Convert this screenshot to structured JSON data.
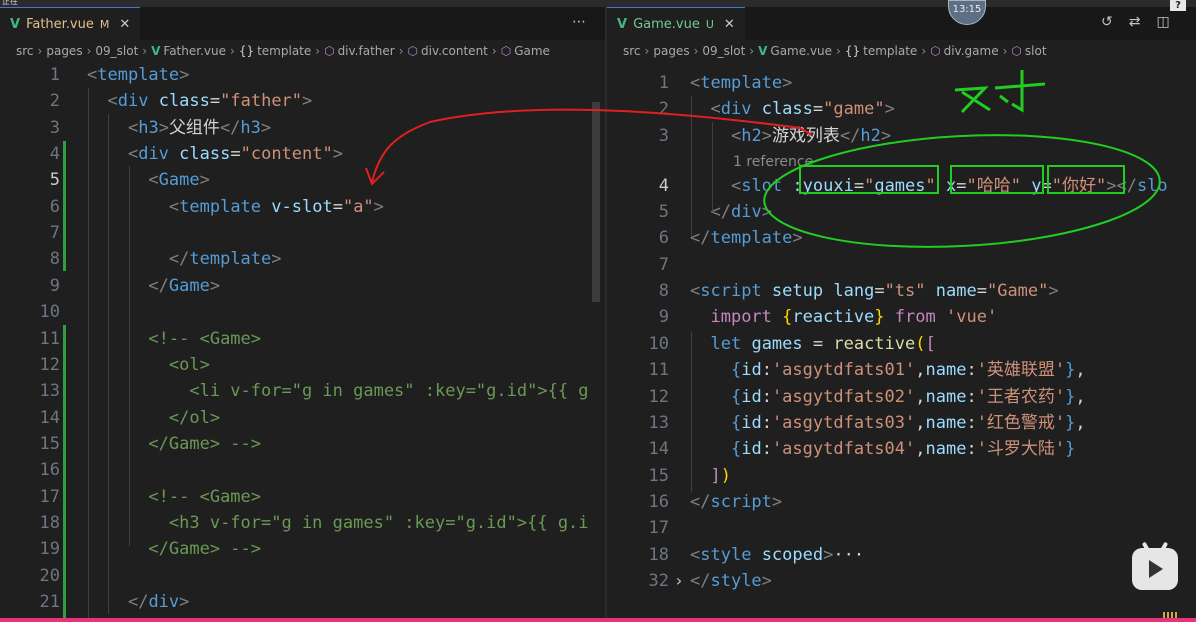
{
  "top_strip_label": "正在",
  "avatar_time": "13:15",
  "help_label": "?",
  "colors": {
    "accent_pink": "#e5357a",
    "annotation_red": "#e02020",
    "annotation_green": "#22cc22",
    "vue_green": "#41b883"
  },
  "left": {
    "tab": {
      "icon": "vue-icon",
      "name": "Father.vue",
      "flag": "M",
      "close": "✕"
    },
    "breadcrumb": [
      "src",
      "pages",
      "09_slot",
      "Father.vue",
      "template",
      "div.father",
      "div.content",
      "Game"
    ],
    "lines": [
      {
        "n": "1",
        "html_parts": [
          [
            "t",
            "<"
          ],
          [
            "tg",
            "template"
          ],
          [
            "t",
            ">"
          ]
        ]
      },
      {
        "n": "2",
        "html_parts": [
          [
            "pl",
            "  "
          ],
          [
            "t",
            "<"
          ],
          [
            "tg",
            "div"
          ],
          [
            "pl",
            " "
          ],
          [
            "at",
            "class"
          ],
          [
            "pl",
            "="
          ],
          [
            "st",
            "\"father\""
          ],
          [
            "t",
            ">"
          ]
        ]
      },
      {
        "n": "3",
        "html_parts": [
          [
            "pl",
            "    "
          ],
          [
            "t",
            "<"
          ],
          [
            "tg",
            "h3"
          ],
          [
            "t",
            ">"
          ],
          [
            "pl",
            "父组件"
          ],
          [
            "t",
            "</"
          ],
          [
            "tg",
            "h3"
          ],
          [
            "t",
            ">"
          ]
        ]
      },
      {
        "n": "4",
        "html_parts": [
          [
            "pl",
            "    "
          ],
          [
            "t",
            "<"
          ],
          [
            "tg",
            "div"
          ],
          [
            "pl",
            " "
          ],
          [
            "at",
            "class"
          ],
          [
            "pl",
            "="
          ],
          [
            "st",
            "\"content\""
          ],
          [
            "t",
            ">"
          ]
        ]
      },
      {
        "n": "5",
        "html_parts": [
          [
            "pl",
            "      "
          ],
          [
            "t",
            "<"
          ],
          [
            "tg",
            "Game"
          ],
          [
            "t",
            ">"
          ]
        ]
      },
      {
        "n": "6",
        "html_parts": [
          [
            "pl",
            "        "
          ],
          [
            "t",
            "<"
          ],
          [
            "tg",
            "template"
          ],
          [
            "pl",
            " "
          ],
          [
            "at",
            "v-slot"
          ],
          [
            "pl",
            "="
          ],
          [
            "st",
            "\"a\""
          ],
          [
            "t",
            ">"
          ]
        ]
      },
      {
        "n": "7",
        "html_parts": []
      },
      {
        "n": "8",
        "html_parts": [
          [
            "pl",
            "        "
          ],
          [
            "t",
            "</"
          ],
          [
            "tg",
            "template"
          ],
          [
            "t",
            ">"
          ]
        ]
      },
      {
        "n": "9",
        "html_parts": [
          [
            "pl",
            "      "
          ],
          [
            "t",
            "</"
          ],
          [
            "tg",
            "Game"
          ],
          [
            "t",
            ">"
          ]
        ]
      },
      {
        "n": "10",
        "html_parts": []
      },
      {
        "n": "11",
        "html_parts": [
          [
            "pl",
            "      "
          ],
          [
            "cm",
            "<!-- <Game>"
          ]
        ]
      },
      {
        "n": "12",
        "html_parts": [
          [
            "pl",
            "        "
          ],
          [
            "cm",
            "<ol>"
          ]
        ]
      },
      {
        "n": "13",
        "html_parts": [
          [
            "pl",
            "          "
          ],
          [
            "cm",
            "<li v-for=\"g in games\" :key=\"g.id\">{{ g"
          ]
        ]
      },
      {
        "n": "14",
        "html_parts": [
          [
            "pl",
            "        "
          ],
          [
            "cm",
            "</ol>"
          ]
        ]
      },
      {
        "n": "15",
        "html_parts": [
          [
            "pl",
            "      "
          ],
          [
            "cm",
            "</Game> -->"
          ]
        ]
      },
      {
        "n": "16",
        "html_parts": []
      },
      {
        "n": "17",
        "html_parts": [
          [
            "pl",
            "      "
          ],
          [
            "cm",
            "<!-- <Game>"
          ]
        ]
      },
      {
        "n": "18",
        "html_parts": [
          [
            "pl",
            "        "
          ],
          [
            "cm",
            "<h3 v-for=\"g in games\" :key=\"g.id\">{{ g.i"
          ]
        ]
      },
      {
        "n": "19",
        "html_parts": [
          [
            "pl",
            "      "
          ],
          [
            "cm",
            "</Game> -->"
          ]
        ]
      },
      {
        "n": "20",
        "html_parts": []
      },
      {
        "n": "21",
        "html_parts": [
          [
            "pl",
            "    "
          ],
          [
            "t",
            "</"
          ],
          [
            "tg",
            "div"
          ],
          [
            "t",
            ">"
          ]
        ]
      }
    ]
  },
  "right": {
    "tab": {
      "icon": "vue-icon",
      "name": "Game.vue",
      "flag": "U",
      "close": "✕"
    },
    "breadcrumb": [
      "src",
      "pages",
      "09_slot",
      "Game.vue",
      "template",
      "div.game",
      "slot"
    ],
    "reference_lens": "1 reference",
    "lines": [
      {
        "n": "1",
        "html_parts": [
          [
            "t",
            "<"
          ],
          [
            "tg",
            "template"
          ],
          [
            "t",
            ">"
          ]
        ]
      },
      {
        "n": "2",
        "html_parts": [
          [
            "pl",
            "  "
          ],
          [
            "t",
            "<"
          ],
          [
            "tg",
            "div"
          ],
          [
            "pl",
            " "
          ],
          [
            "at",
            "class"
          ],
          [
            "pl",
            "="
          ],
          [
            "st",
            "\"game\""
          ],
          [
            "t",
            ">"
          ]
        ]
      },
      {
        "n": "3",
        "html_parts": [
          [
            "pl",
            "    "
          ],
          [
            "t",
            "<"
          ],
          [
            "tg",
            "h2"
          ],
          [
            "t",
            ">"
          ],
          [
            "pl",
            "游戏列表"
          ],
          [
            "t",
            "</"
          ],
          [
            "tg",
            "h2"
          ],
          [
            "t",
            ">"
          ]
        ]
      },
      {
        "n": "4",
        "html_parts": [
          [
            "pl",
            "    "
          ],
          [
            "t",
            "<"
          ],
          [
            "tg",
            "slot"
          ],
          [
            "pl",
            " "
          ],
          [
            "at",
            ":youxi"
          ],
          [
            "pl",
            "="
          ],
          [
            "st",
            "\""
          ],
          [
            "vr",
            "games"
          ],
          [
            "st",
            "\""
          ],
          [
            "pl",
            " "
          ],
          [
            "at",
            "x"
          ],
          [
            "pl",
            "="
          ],
          [
            "st",
            "\"哈哈\""
          ],
          [
            "pl",
            " "
          ],
          [
            "at",
            "y"
          ],
          [
            "pl",
            "="
          ],
          [
            "st",
            "\"你好\""
          ],
          [
            "t",
            "></"
          ],
          [
            "tg",
            "slo"
          ]
        ]
      },
      {
        "n": "5",
        "html_parts": [
          [
            "pl",
            "  "
          ],
          [
            "t",
            "</"
          ],
          [
            "tg",
            "div"
          ],
          [
            "t",
            ">"
          ]
        ]
      },
      {
        "n": "6",
        "html_parts": [
          [
            "t",
            "</"
          ],
          [
            "tg",
            "template"
          ],
          [
            "t",
            ">"
          ]
        ]
      },
      {
        "n": "7",
        "html_parts": []
      },
      {
        "n": "8",
        "html_parts": [
          [
            "t",
            "<"
          ],
          [
            "tg",
            "script"
          ],
          [
            "pl",
            " "
          ],
          [
            "at",
            "setup"
          ],
          [
            "pl",
            " "
          ],
          [
            "at",
            "lang"
          ],
          [
            "pl",
            "="
          ],
          [
            "st",
            "\"ts\""
          ],
          [
            "pl",
            " "
          ],
          [
            "at",
            "name"
          ],
          [
            "pl",
            "="
          ],
          [
            "st",
            "\"Game\""
          ],
          [
            "t",
            ">"
          ]
        ]
      },
      {
        "n": "9",
        "html_parts": [
          [
            "pl",
            "  "
          ],
          [
            "kw",
            "import"
          ],
          [
            "pl",
            " "
          ],
          [
            "br",
            "{"
          ],
          [
            "vr",
            "reactive"
          ],
          [
            "br",
            "}"
          ],
          [
            "pl",
            " "
          ],
          [
            "kw",
            "from"
          ],
          [
            "pl",
            " "
          ],
          [
            "st",
            "'vue'"
          ]
        ]
      },
      {
        "n": "10",
        "html_parts": [
          [
            "pl",
            "  "
          ],
          [
            "kw2",
            "let"
          ],
          [
            "pl",
            " "
          ],
          [
            "vr",
            "games"
          ],
          [
            "pl",
            " = "
          ],
          [
            "fn",
            "reactive"
          ],
          [
            "br",
            "("
          ],
          [
            "kw",
            "["
          ]
        ]
      },
      {
        "n": "11",
        "html_parts": [
          [
            "pl",
            "    "
          ],
          [
            "tg",
            "{"
          ],
          [
            "vr",
            "id"
          ],
          [
            "pl",
            ":"
          ],
          [
            "st",
            "'asgytdfats01'"
          ],
          [
            "pl",
            ","
          ],
          [
            "vr",
            "name"
          ],
          [
            "pl",
            ":"
          ],
          [
            "st",
            "'英雄联盟'"
          ],
          [
            "tg",
            "}"
          ],
          [
            "pl",
            ","
          ]
        ]
      },
      {
        "n": "12",
        "html_parts": [
          [
            "pl",
            "    "
          ],
          [
            "tg",
            "{"
          ],
          [
            "vr",
            "id"
          ],
          [
            "pl",
            ":"
          ],
          [
            "st",
            "'asgytdfats02'"
          ],
          [
            "pl",
            ","
          ],
          [
            "vr",
            "name"
          ],
          [
            "pl",
            ":"
          ],
          [
            "st",
            "'王者农药'"
          ],
          [
            "tg",
            "}"
          ],
          [
            "pl",
            ","
          ]
        ]
      },
      {
        "n": "13",
        "html_parts": [
          [
            "pl",
            "    "
          ],
          [
            "tg",
            "{"
          ],
          [
            "vr",
            "id"
          ],
          [
            "pl",
            ":"
          ],
          [
            "st",
            "'asgytdfats03'"
          ],
          [
            "pl",
            ","
          ],
          [
            "vr",
            "name"
          ],
          [
            "pl",
            ":"
          ],
          [
            "st",
            "'红色警戒'"
          ],
          [
            "tg",
            "}"
          ],
          [
            "pl",
            ","
          ]
        ]
      },
      {
        "n": "14",
        "html_parts": [
          [
            "pl",
            "    "
          ],
          [
            "tg",
            "{"
          ],
          [
            "vr",
            "id"
          ],
          [
            "pl",
            ":"
          ],
          [
            "st",
            "'asgytdfats04'"
          ],
          [
            "pl",
            ","
          ],
          [
            "vr",
            "name"
          ],
          [
            "pl",
            ":"
          ],
          [
            "st",
            "'斗罗大陆'"
          ],
          [
            "tg",
            "}"
          ]
        ]
      },
      {
        "n": "15",
        "html_parts": [
          [
            "pl",
            "  "
          ],
          [
            "kw",
            "]"
          ],
          [
            "br",
            ")"
          ]
        ]
      },
      {
        "n": "16",
        "html_parts": [
          [
            "t",
            "</"
          ],
          [
            "tg",
            "script"
          ],
          [
            "t",
            ">"
          ]
        ]
      },
      {
        "n": "17",
        "html_parts": []
      },
      {
        "n": "18",
        "html_parts": [
          [
            "t",
            "<"
          ],
          [
            "tg",
            "style"
          ],
          [
            "pl",
            " "
          ],
          [
            "at",
            "scoped"
          ],
          [
            "t",
            ">"
          ],
          [
            "pl",
            "···"
          ]
        ]
      },
      {
        "n": "32",
        "html_parts": [
          [
            "t",
            "</"
          ],
          [
            "tg",
            "style"
          ],
          [
            "t",
            ">"
          ]
        ]
      }
    ]
  },
  "annotation": {
    "handwritten_text": "又寸"
  }
}
